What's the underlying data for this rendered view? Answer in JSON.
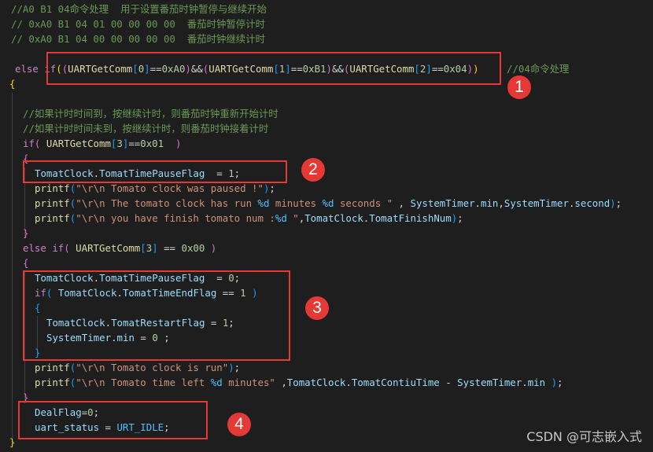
{
  "lines": [
    "//A0 B1 04命令处理  用于设置番茄时钟暂停与继续开始",
    "// 0xA0 B1 04 01 00 00 00 00  番茄时钟暂停计时",
    "// 0xA0 B1 04 00 00 00 00 00  番茄时钟继续计时",
    "",
    "else if((UARTGetComm[0]==0xA0)&&(UARTGetComm[1]==0xB1)&&(UARTGetComm[2]==0x04))",
    "//04命令处理",
    "{",
    "//如果计时时间到，按继续计时，则番茄时钟重新开始计时",
    "//如果计时时间未到，按继续计时，则番茄时钟接着计时",
    "if( UARTGetComm[3]==0x01  )",
    "{",
    "TomatClock.TomatTimePauseFlag  = 1;",
    "printf(\"\\r\\n Tomato clock was paused !\");",
    "printf(\"\\r\\n The tomato clock has run %d minutes %d seconds \" , SystemTimer.min,SystemTimer.second);",
    "printf(\"\\r\\n you have finish tomato num :%d \",TomatClock.TomatFinishNum);",
    "}",
    "else if( UARTGetComm[3] == 0x00 )",
    "{",
    "TomatClock.TomatTimePauseFlag  = 0;",
    "if( TomatClock.TomatTimeEndFlag == 1 )",
    "{",
    "TomatClock.TomatRestartFlag = 1;",
    "SystemTimer.min = 0 ;",
    "}",
    "printf(\"\\r\\n Tomato clock is run\");",
    "printf(\"\\r\\n Tomato time left %d minutes\" ,TomatClock.TomatContiuTime - SystemTimer.min );",
    "}",
    "DealFlag=0;",
    "uart_status = URT_IDLE;",
    "}"
  ],
  "tokens": {
    "l4_c1": "else",
    "l4_c2": "if",
    "l4_c3": "UARTGetComm",
    "l4_c4": "0",
    "l4_c5": "0xA0",
    "l4_c6": "UARTGetComm",
    "l4_c7": "1",
    "l4_c8": "0xB1",
    "l4_c9": "UARTGetComm",
    "l4_c10": "2",
    "l4_c11": "0x04",
    "l9_c1": "if",
    "l9_c2": "UARTGetComm",
    "l9_c3": "3",
    "l9_c4": "0x01",
    "l11_c1": "TomatClock",
    "l11_c2": "TomatTimePauseFlag",
    "l11_c3": "1",
    "l12_c1": "printf",
    "l12_c2": "\"\\r\\n Tomato clock was paused !\"",
    "l13_c1": "printf",
    "l13_c2": "\"\\r\\n The tomato clock has run ",
    "l13_c3": "%d",
    "l13_c4": " minutes ",
    "l13_c5": "%d",
    "l13_c6": " seconds \"",
    "l13_c7": "SystemTimer",
    "l13_c8": "min",
    "l13_c9": "SystemTimer",
    "l13_c10": "second",
    "l14_c1": "printf",
    "l14_c2": "\"\\r\\n you have finish tomato num :",
    "l14_c3": "%d",
    "l14_c4": " \"",
    "l14_c5": "TomatClock",
    "l14_c6": "TomatFinishNum",
    "l16_c1": "else",
    "l16_c2": "if",
    "l16_c3": "UARTGetComm",
    "l16_c4": "3",
    "l16_c5": "0x00",
    "l18_c1": "TomatClock",
    "l18_c2": "TomatTimePauseFlag",
    "l18_c3": "0",
    "l19_c1": "if",
    "l19_c2": "TomatClock",
    "l19_c3": "TomatTimeEndFlag",
    "l19_c4": "1",
    "l21_c1": "TomatClock",
    "l21_c2": "TomatRestartFlag",
    "l21_c3": "1",
    "l22_c1": "SystemTimer",
    "l22_c2": "min",
    "l22_c3": "0",
    "l24_c1": "printf",
    "l24_c2": "\"\\r\\n Tomato clock is run\"",
    "l25_c1": "printf",
    "l25_c2": "\"\\r\\n Tomato time left ",
    "l25_c3": "%d",
    "l25_c4": " minutes\"",
    "l25_c5": "TomatClock",
    "l25_c6": "TomatContiuTime",
    "l25_c7": "SystemTimer",
    "l25_c8": "min",
    "l27_c1": "DealFlag",
    "l27_c2": "0",
    "l28_c1": "uart_status",
    "l28_c2": "URT_IDLE"
  },
  "badges": [
    "1",
    "2",
    "3",
    "4"
  ],
  "watermark": "CSDN @可志嵌入式",
  "colors": {
    "background": "#1e1e1e",
    "comment": "#6a9955",
    "keyword": "#c586c0",
    "function": "#dcdcaa",
    "variable": "#9cdcfe",
    "number": "#b5cea8",
    "string": "#ce9178",
    "constant": "#4fc1ff",
    "annotation": "#e53935"
  }
}
